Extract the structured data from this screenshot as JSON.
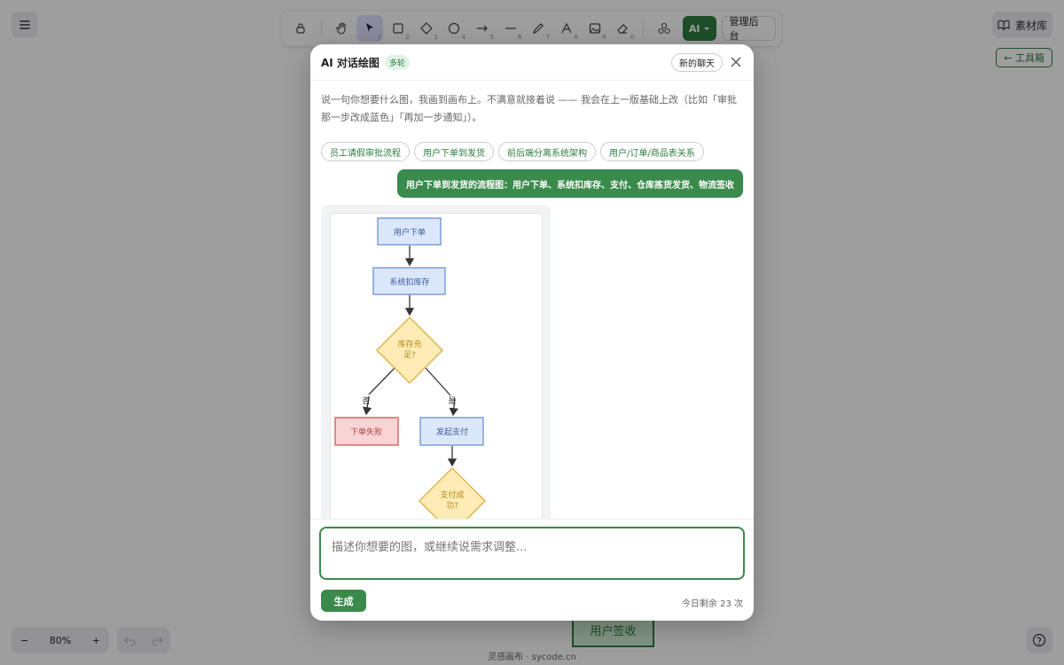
{
  "toolbar": {
    "tool_numbers": [
      "1",
      "2",
      "3",
      "4",
      "5",
      "6",
      "7",
      "8",
      "9",
      "0"
    ],
    "ai_label": "AI",
    "admin_label": "管理后台"
  },
  "library_label": "素材库",
  "toolbox_label": "← 工具箱",
  "zoom": {
    "level": "80%",
    "minus": "−",
    "plus": "+"
  },
  "canvas_node": "用户签收",
  "footer": "灵感画布 · sycode.cn",
  "modal": {
    "title": "AI 对话绘图",
    "badge": "多轮",
    "new_chat": "新的聊天",
    "desc": "说一句你想要什么图，我画到画布上。不满意就接着说 —— 我会在上一版基础上改（比如「审批那一步改成蓝色」「再加一步通知」）。",
    "suggestions": [
      "员工请假审批流程",
      "用户下单到发货",
      "前后端分离系统架构",
      "用户/订单/商品表关系"
    ],
    "user_message": "用户下单到发货的流程图：用户下单、系统扣库存、支付、仓库拣货发货、物流签收",
    "diagram": {
      "n1": "用户下单",
      "n2": "系统扣库存",
      "d1_line1": "库存充",
      "d1_line2": "足?",
      "no": "否",
      "yes": "是",
      "fail": "下单失败",
      "pay": "发起支付",
      "d2_line1": "支付成",
      "d2_line2": "功?"
    },
    "input_placeholder": "描述你想要的图，或继续说需求调整...",
    "generate": "生成",
    "quota": "今日剩余 23 次"
  }
}
